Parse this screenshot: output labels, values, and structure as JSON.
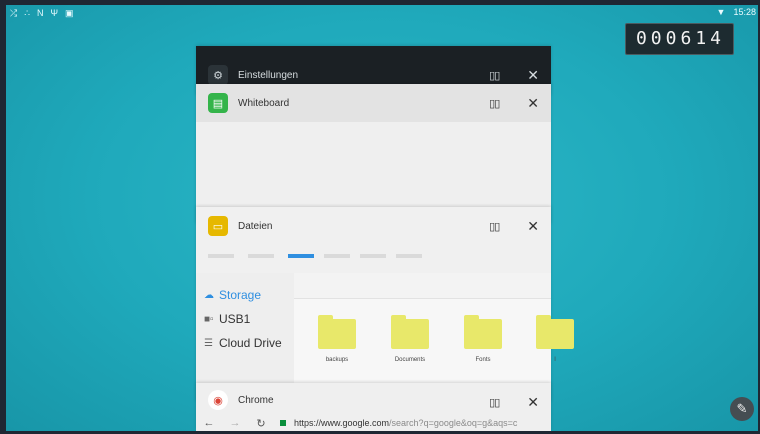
{
  "statusbar": {
    "left_icons": [
      "⤮",
      "∴",
      "N",
      "Ψ",
      "▣"
    ],
    "wifi_icon": "▼",
    "time": "15:28"
  },
  "counter": "000614",
  "cards": {
    "settings": {
      "title": "Einstellungen",
      "icon": "⚙",
      "split": "▯▯",
      "close": "✕"
    },
    "whiteboard": {
      "title": "Whiteboard",
      "icon": "▤",
      "split": "▯▯",
      "close": "✕",
      "accent": "#34b44a"
    },
    "files": {
      "title": "Dateien",
      "icon": "▭",
      "split": "▯▯",
      "close": "✕",
      "accent": "#e6b800",
      "sidebar": [
        {
          "icon": "☁",
          "label": "Storage"
        },
        {
          "icon": "■▫",
          "label": "USB1"
        },
        {
          "icon": "☰",
          "label": "Cloud Drive"
        }
      ],
      "folders": [
        "backups",
        "Documents",
        "Fonts",
        "l"
      ]
    },
    "chrome": {
      "title": "Chrome",
      "icon": "◉",
      "split": "▯▯",
      "close": "✕",
      "back": "←",
      "forward": "→",
      "reload": "↻",
      "url_host": "https://www.google.com",
      "url_path": "/search?q=google&oq=g&aqs=c"
    }
  },
  "fab_icon": "✎"
}
